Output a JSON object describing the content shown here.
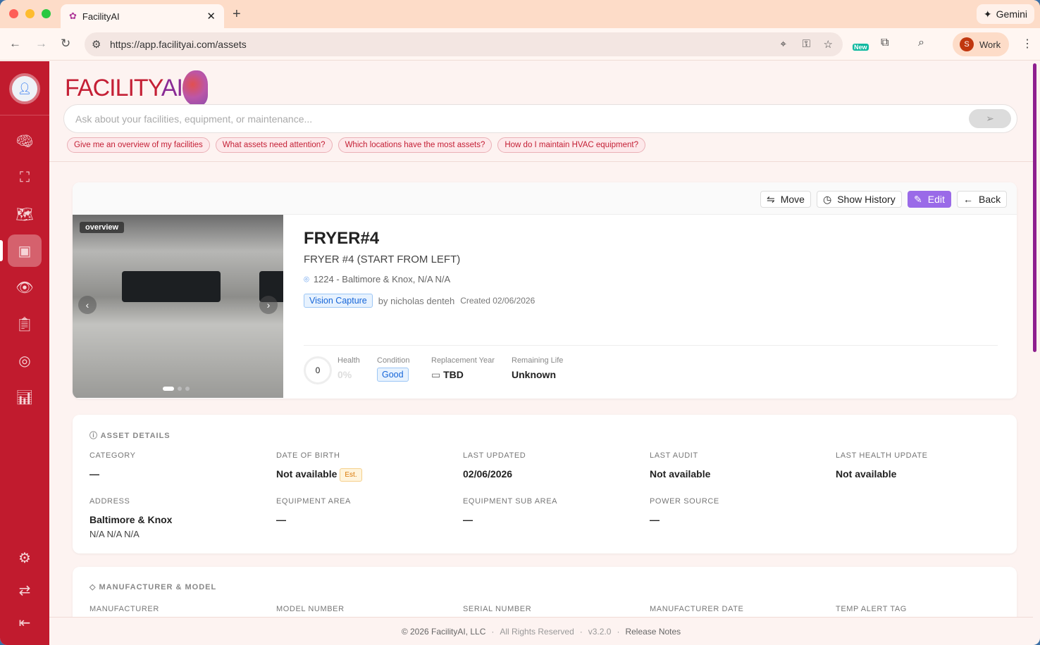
{
  "browser": {
    "tab_title": "FacilityAI",
    "url": "https://app.facilityai.com/assets",
    "gemini": "Gemini",
    "profile_initial": "S",
    "profile": "Work",
    "new_badge": "New"
  },
  "logo": {
    "text_main": "FACILITY",
    "text_ai": "AI"
  },
  "ask": {
    "placeholder": "Ask about your facilities, equipment, or maintenance...",
    "suggestions": [
      "Give me an overview of my facilities",
      "What assets need attention?",
      "Which locations have the most assets?",
      "How do I maintain HVAC equipment?"
    ]
  },
  "toolbar": {
    "move": "Move",
    "history": "Show History",
    "edit": "Edit",
    "back": "Back"
  },
  "asset": {
    "photo_label": "overview",
    "name": "FRYER#4",
    "description": "FRYER #4 (START FROM LEFT)",
    "location": "1224 - Baltimore & Knox, N/A N/A",
    "source_tag": "Vision Capture",
    "by": "by nicholas denteh",
    "created": "Created 02/06/2026",
    "health_score": "0",
    "health_label": "Health",
    "health_pct": "0%",
    "condition_label": "Condition",
    "condition": "Good",
    "replacement_label": "Replacement Year",
    "replacement": "TBD",
    "remaining_label": "Remaining Life",
    "remaining": "Unknown"
  },
  "details": {
    "title": "ASSET DETAILS",
    "fields": [
      {
        "label": "CATEGORY",
        "value": "—"
      },
      {
        "label": "DATE OF BIRTH",
        "value": "Not available",
        "badge": "Est."
      },
      {
        "label": "LAST UPDATED",
        "value": "02/06/2026"
      },
      {
        "label": "LAST AUDIT",
        "value": "Not available"
      },
      {
        "label": "LAST HEALTH UPDATE",
        "value": "Not available"
      },
      {
        "label": "ADDRESS",
        "value": "Baltimore & Knox",
        "value2": "N/A N/A N/A"
      },
      {
        "label": "EQUIPMENT AREA",
        "value": "—"
      },
      {
        "label": "EQUIPMENT SUB AREA",
        "value": "—"
      },
      {
        "label": "POWER SOURCE",
        "value": "—"
      }
    ]
  },
  "manufacturer": {
    "title": "MANUFACTURER & MODEL",
    "fields": [
      "MANUFACTURER",
      "MODEL NUMBER",
      "SERIAL NUMBER",
      "MANUFACTURER DATE",
      "TEMP ALERT TAG"
    ]
  },
  "footer": {
    "copyright": "© 2026 FacilityAI, LLC",
    "rights": "All Rights Reserved",
    "version": "v3.2.0",
    "release": "Release Notes",
    "sep": "·"
  }
}
